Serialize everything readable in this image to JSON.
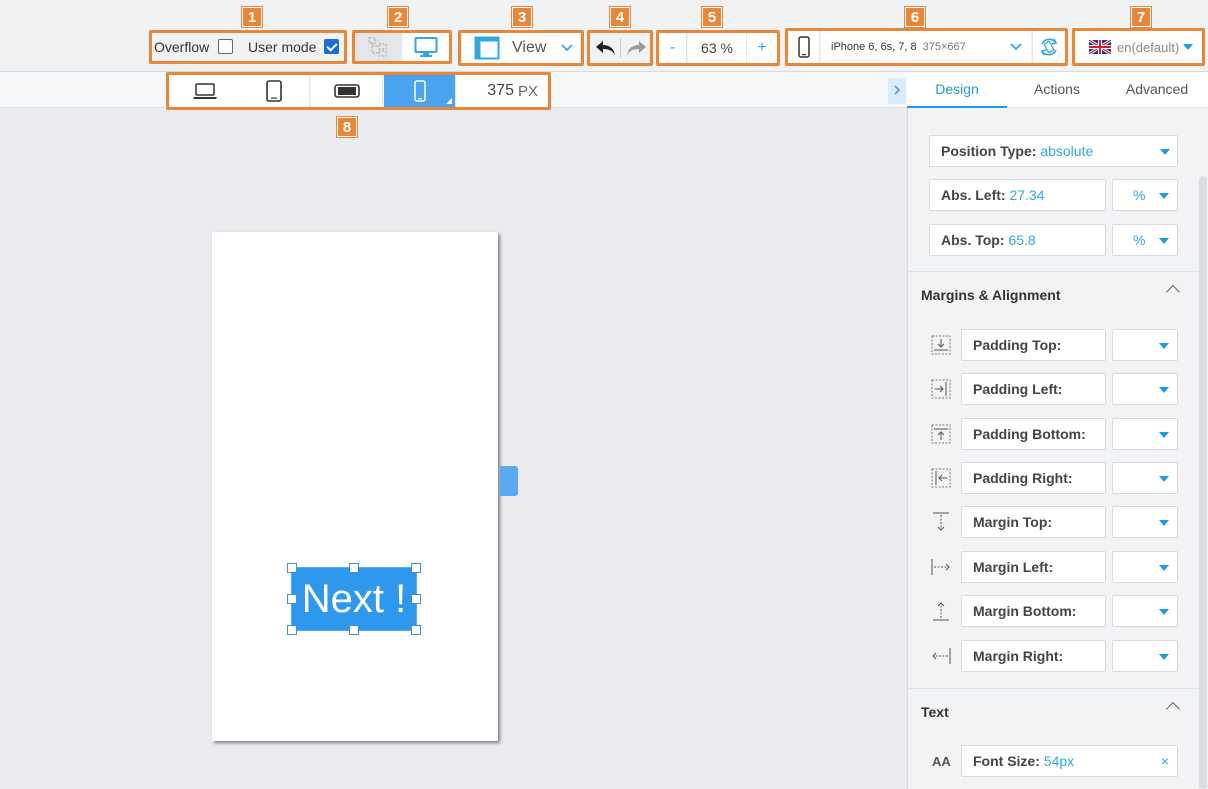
{
  "annotations": [
    "1",
    "2",
    "3",
    "4",
    "5",
    "6",
    "7",
    "8"
  ],
  "toolbar": {
    "overflow_label": "Overflow",
    "overflow_checked": false,
    "user_mode_label": "User mode",
    "user_mode_checked": true,
    "view_label": "View",
    "zoom_minus": "-",
    "zoom_value": "63 %",
    "zoom_plus": "+",
    "device_name": "iPhone 6, 6s, 7, 8",
    "device_size": "375×667",
    "language": "en(default)"
  },
  "device_row": {
    "width_value": "375",
    "width_unit": "PX"
  },
  "canvas": {
    "button_text": "Next !"
  },
  "panel": {
    "tabs": [
      "Design",
      "Actions",
      "Advanced"
    ],
    "position_type_label": "Position Type:",
    "position_type_value": "absolute",
    "abs_left_label": "Abs. Left:",
    "abs_left_value": "27.34",
    "abs_left_unit": "%",
    "abs_top_label": "Abs. Top:",
    "abs_top_value": "65.8",
    "abs_top_unit": "%",
    "margins_title": "Margins & Alignment",
    "spacing": [
      {
        "label": "Padding Top:",
        "icon": "padding-top-icon"
      },
      {
        "label": "Padding Left:",
        "icon": "padding-left-icon"
      },
      {
        "label": "Padding Bottom:",
        "icon": "padding-bottom-icon"
      },
      {
        "label": "Padding Right:",
        "icon": "padding-right-icon"
      },
      {
        "label": "Margin Top:",
        "icon": "margin-top-icon"
      },
      {
        "label": "Margin Left:",
        "icon": "margin-left-icon"
      },
      {
        "label": "Margin Bottom:",
        "icon": "margin-bottom-icon"
      },
      {
        "label": "Margin Right:",
        "icon": "margin-right-icon"
      }
    ],
    "text_title": "Text",
    "font_icon_label": "AA",
    "font_size_label": "Font Size:",
    "font_size_value": "54px",
    "clear_symbol": "×"
  },
  "colors": {
    "accent": "#1d9be4",
    "annotation": "#e8863a",
    "active_device": "#4aa3f0",
    "button_bg": "#2e98ec"
  }
}
